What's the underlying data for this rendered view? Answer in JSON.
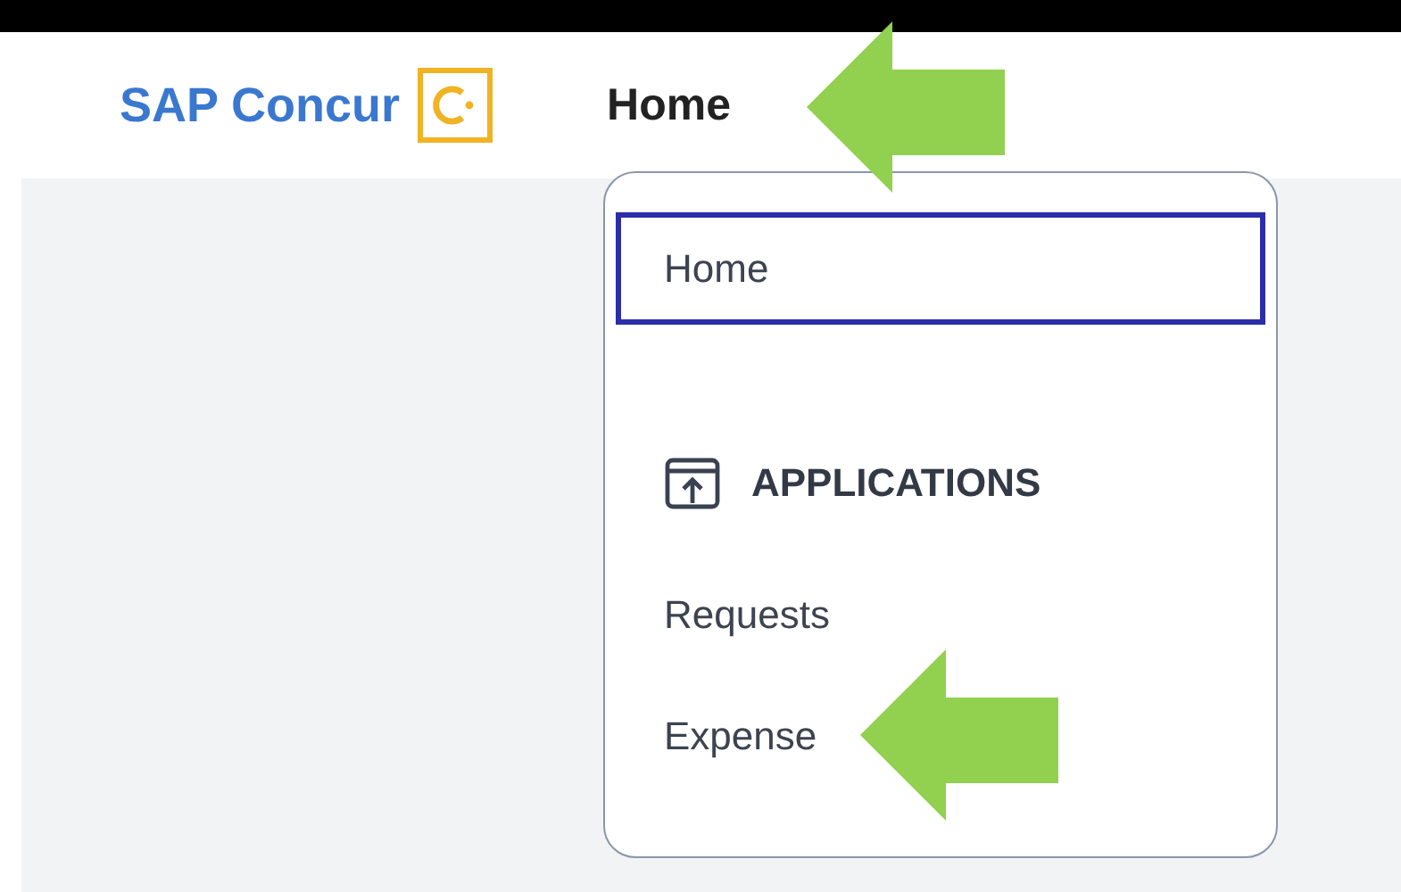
{
  "header": {
    "brand": "SAP Concur",
    "nav_label": "Home"
  },
  "menu": {
    "items": [
      {
        "label": "Home",
        "selected": true
      }
    ],
    "section": {
      "title": "APPLICATIONS",
      "items": [
        {
          "label": "Requests",
          "selected": false
        },
        {
          "label": "Expense",
          "selected": false
        }
      ]
    }
  },
  "annotations": [
    {
      "kind": "arrow"
    },
    {
      "kind": "arrow"
    }
  ]
}
